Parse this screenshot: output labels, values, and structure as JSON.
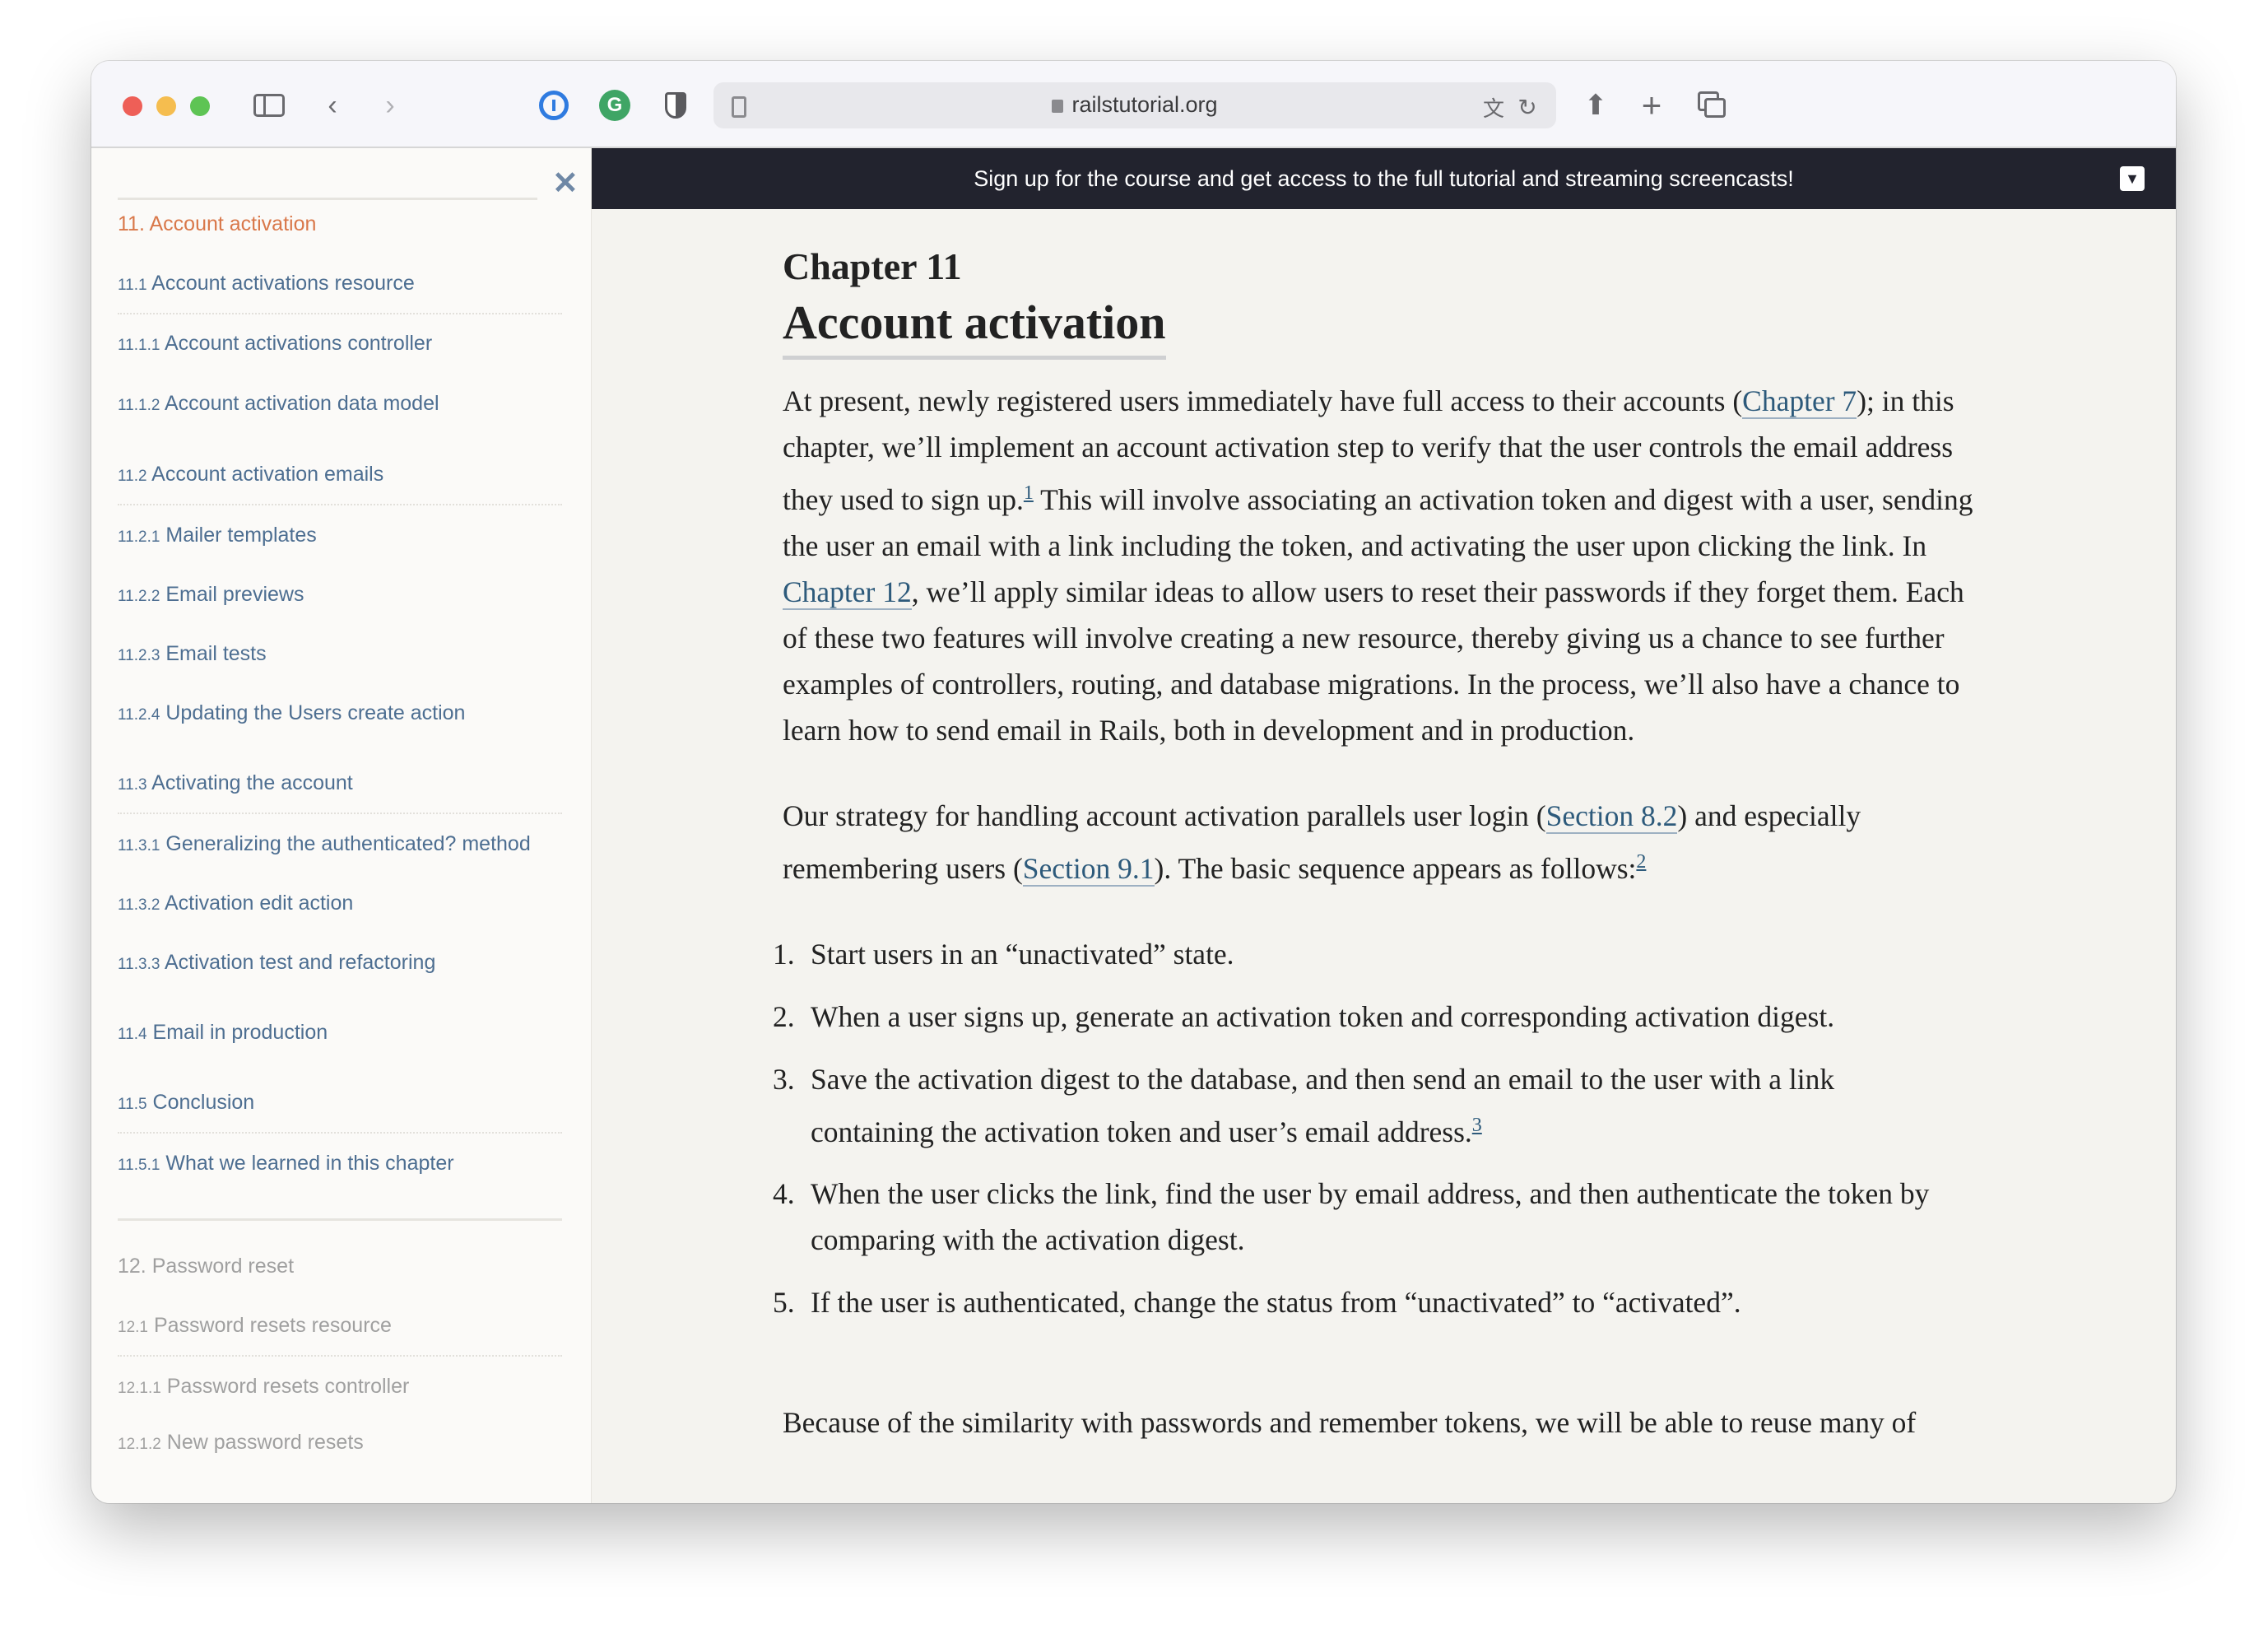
{
  "browser": {
    "url": "railstutorial.org",
    "icons": [
      "sidebar-toggle-icon",
      "back-icon",
      "forward-icon",
      "1password-icon",
      "grammarly-icon",
      "privacy-shield-icon",
      "reader-icon",
      "lock-icon",
      "translate-icon",
      "reload-icon",
      "share-icon",
      "new-tab-icon",
      "tabs-overview-icon"
    ]
  },
  "banner": {
    "text": "Sign up for the course and get access to the full tutorial and streaming screencasts!"
  },
  "sidebar": {
    "items": [
      {
        "num": "11.",
        "label": "Account activation"
      },
      {
        "num": "11.1",
        "label": "Account activations resource"
      },
      {
        "num": "11.1.1",
        "label": "Account activations controller"
      },
      {
        "num": "11.1.2",
        "label": "Account activation data model"
      },
      {
        "num": "11.2",
        "label": "Account activation emails"
      },
      {
        "num": "11.2.1",
        "label": "Mailer templates"
      },
      {
        "num": "11.2.2",
        "label": "Email previews"
      },
      {
        "num": "11.2.3",
        "label": "Email tests"
      },
      {
        "num": "11.2.4",
        "label": "Updating the Users create action"
      },
      {
        "num": "11.3",
        "label": "Activating the account"
      },
      {
        "num": "11.3.1",
        "label": "Generalizing the authenticated? method"
      },
      {
        "num": "11.3.2",
        "label": "Activation edit action"
      },
      {
        "num": "11.3.3",
        "label": "Activation test and refactoring"
      },
      {
        "num": "11.4",
        "label": "Email in production"
      },
      {
        "num": "11.5",
        "label": "Conclusion"
      },
      {
        "num": "11.5.1",
        "label": "What we learned in this chapter"
      },
      {
        "num": "12.",
        "label": "Password reset"
      },
      {
        "num": "12.1",
        "label": "Password resets resource"
      },
      {
        "num": "12.1.1",
        "label": "Password resets controller"
      },
      {
        "num": "12.1.2",
        "label": "New password resets"
      }
    ]
  },
  "main": {
    "chapter_label": "Chapter 11",
    "title": "Account activation",
    "p1": {
      "a": "At present, newly registered users immediately have full access to their accounts (",
      "link1": "Chapter 7",
      "b": "); in this chapter, we’ll implement an account activation step to verify that the user controls the email address they used to sign up.",
      "fn1": "1",
      "c": " This will involve associating an activation token and digest with a user, sending the user an email with a link including the token, and activating the user upon clicking the link.  In ",
      "link2": "Chapter 12",
      "d": ", we’ll apply similar ideas to allow users to reset their passwords if they forget them.  Each of these two features will involve creating a new resource, thereby giving us a chance to see further examples of controllers, routing, and database migrations.  In the process, we’ll also have a chance to learn how to send email in Rails, both in development and in production."
    },
    "p2": {
      "a": "Our strategy for handling account activation parallels user login (",
      "link1": "Section 8.2",
      "b": ") and especially remembering users (",
      "link2": "Section 9.1",
      "c": ").  The basic sequence appears as follows:",
      "fn2": "2"
    },
    "steps": [
      {
        "n": "1.",
        "text": "Start users in an “unactivated” state.",
        "fn": ""
      },
      {
        "n": "2.",
        "text": "When a user signs up, generate an activation token and corresponding activation digest.",
        "fn": ""
      },
      {
        "n": "3.",
        "text": "Save the activation digest to the database, and then send an email to the user with a link containing the activation token and user’s email address.",
        "fn": "3"
      },
      {
        "n": "4.",
        "text": "When the user clicks the link, find the user by email address, and then authenticate the token by comparing with the activation digest.",
        "fn": ""
      },
      {
        "n": "5.",
        "text": "If the user is authenticated, change the status from “unactivated” to “activated”.",
        "fn": ""
      }
    ],
    "p3": "Because of the similarity with passwords and remember tokens, we will be able to reuse many of"
  },
  "colors": {
    "accent": "#d9784a",
    "link": "#4d6e91",
    "banner": "#22232e"
  }
}
